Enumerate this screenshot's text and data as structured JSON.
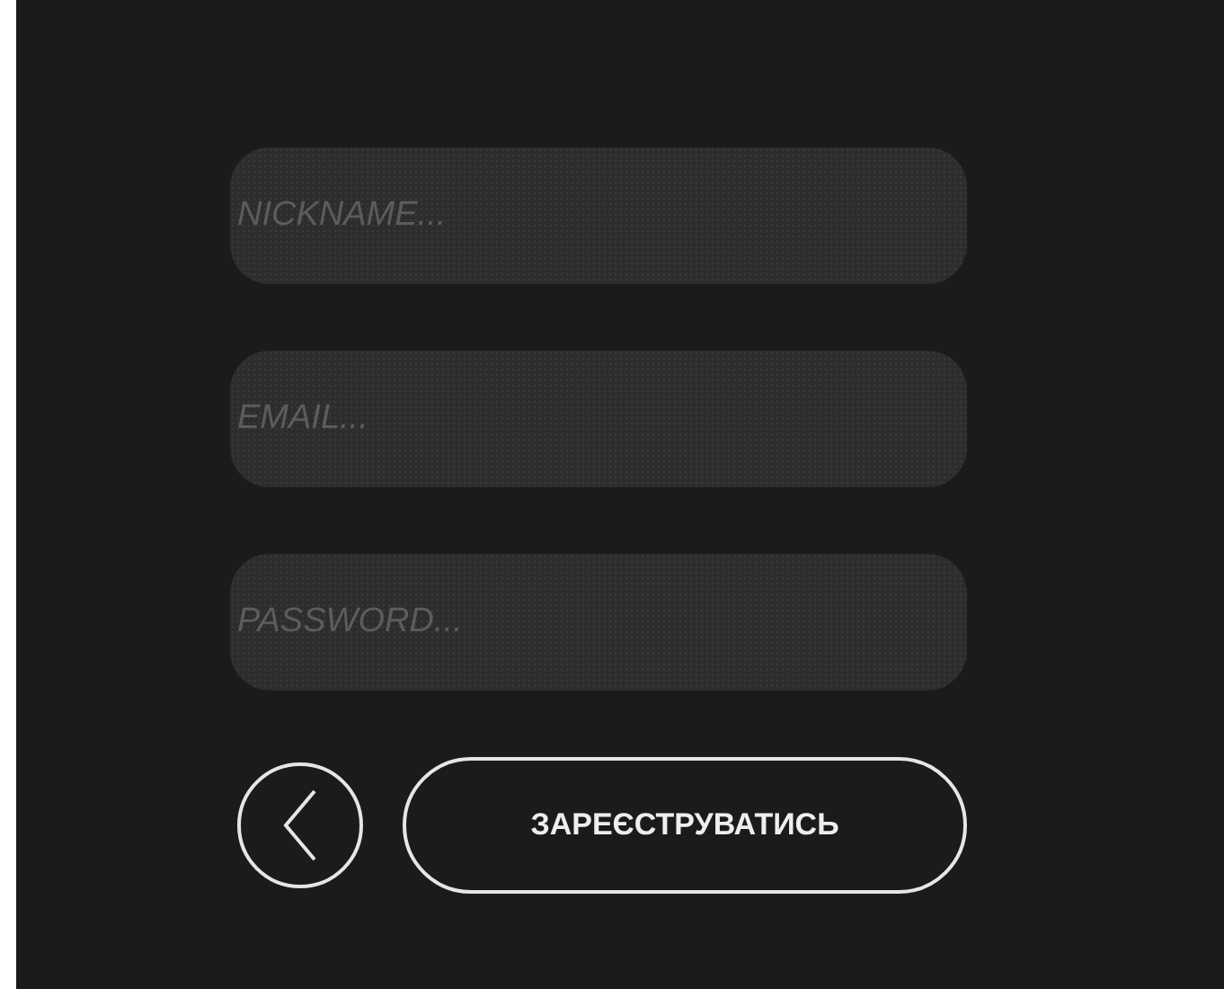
{
  "fields": [
    {
      "placeholder": "NICKNAME..."
    },
    {
      "placeholder": "EMAIL..."
    },
    {
      "placeholder": "PASSWORD..."
    }
  ],
  "submit_button": {
    "label": "ЗАРЕЄСТРУВАТИСЬ"
  }
}
